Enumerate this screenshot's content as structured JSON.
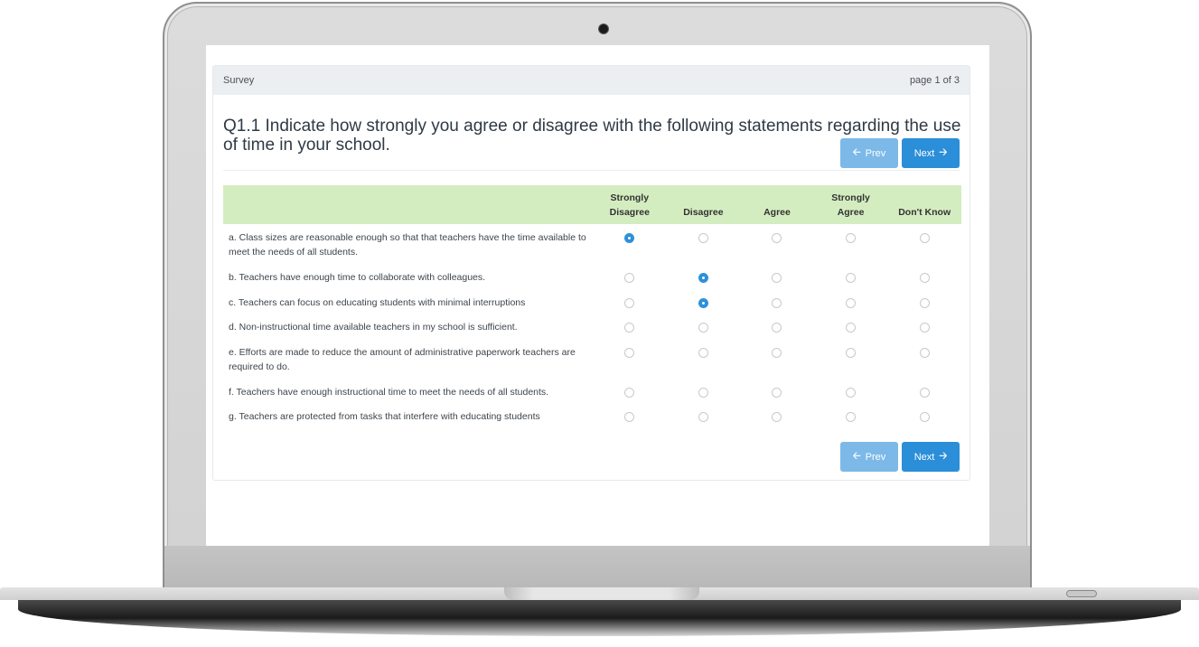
{
  "survey": {
    "header_title": "Survey",
    "page_indicator": "page 1 of 3",
    "question": "Q1.1 Indicate how strongly you agree or disagree with the following statements regarding the use of time in your school.",
    "nav": {
      "prev_label": "Prev",
      "next_label": "Next",
      "prev_icon": "arrow-left-icon",
      "next_icon": "arrow-right-icon"
    },
    "columns": [
      {
        "line1": "Strongly",
        "line2": "Disagree"
      },
      {
        "line1": "",
        "line2": "Disagree"
      },
      {
        "line1": "",
        "line2": "Agree"
      },
      {
        "line1": "Strongly",
        "line2": "Agree"
      },
      {
        "line1": "",
        "line2": "Don't Know"
      }
    ],
    "rows": [
      {
        "text": "a. Class sizes are reasonable enough so that that teachers have the time available to meet the needs of all students.",
        "selected": 0
      },
      {
        "text": "b. Teachers have enough time to collaborate with colleagues.",
        "selected": 1
      },
      {
        "text": "c. Teachers can focus on educating students with minimal interruptions",
        "selected": 1
      },
      {
        "text": "d. Non-instructional time available teachers in my school is sufficient.",
        "selected": null
      },
      {
        "text": "e. Efforts are made to reduce the amount of administrative paperwork teachers are required to do.",
        "selected": null
      },
      {
        "text": "f. Teachers have enough instructional time to meet the needs of all students.",
        "selected": null
      },
      {
        "text": "g. Teachers are protected from tasks that interfere with educating students",
        "selected": null
      }
    ],
    "colors": {
      "accent": "#2b8ed8",
      "prev_button": "#7cb9e8",
      "header_bar": "#eceff1",
      "grid_header": "#d4edc0"
    }
  }
}
